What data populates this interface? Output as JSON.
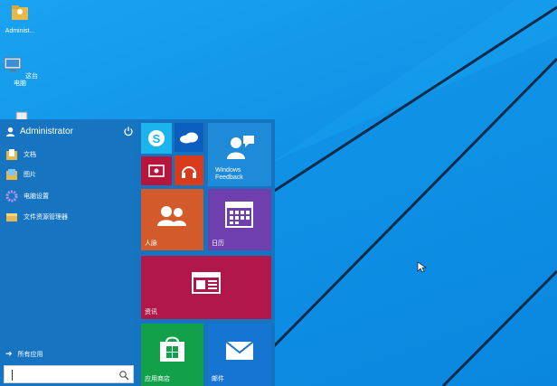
{
  "desktop": {
    "icons": [
      {
        "name": "administrator-folder-icon",
        "label": "Administ..."
      },
      {
        "name": "this-pc-icon",
        "label": "这台电脑"
      },
      {
        "name": "recycle-bin-icon",
        "label": ""
      }
    ]
  },
  "start_menu": {
    "user_name": "Administrator",
    "apps": [
      {
        "label": "文档"
      },
      {
        "label": "图片"
      },
      {
        "label": "电脑设置"
      },
      {
        "label": "文件资源管理器"
      }
    ],
    "all_apps_label": "所有应用",
    "search_placeholder": "",
    "tiles": {
      "windows_feedback": "Windows\nFeedback",
      "people": "人脉",
      "calendar": "日历",
      "news": "资讯",
      "store": "应用商店",
      "mail": "邮件"
    }
  },
  "colors": {
    "desktop_blue": "#0f92e6",
    "start_bg": "#1673bf",
    "skype": "#1bb4ec",
    "onedrive": "#0a5ebd",
    "video": "#b5163e",
    "music": "#d93b1d",
    "feedback": "#1e8ad8",
    "people": "#d35a2a",
    "calendar": "#6f3fae",
    "news": "#b0174a",
    "store": "#13a04a",
    "mail": "#1675d0"
  }
}
